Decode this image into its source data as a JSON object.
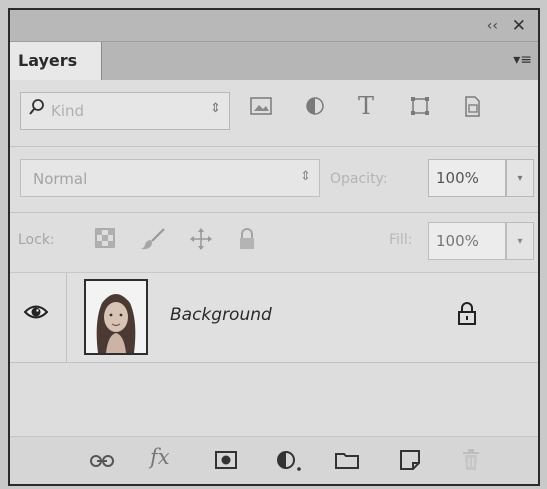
{
  "window": {
    "collapse_glyph": "‹‹",
    "close_glyph": "✕",
    "menu_glyph": "▾≡"
  },
  "tab": {
    "label": "Layers"
  },
  "filter": {
    "kind_label": "Kind",
    "kind_arrows": "⇕",
    "icons": [
      "image-filter-icon",
      "adjustment-filter-icon",
      "type-filter-icon",
      "shape-filter-icon",
      "smart-object-filter-icon"
    ],
    "type_glyph": "T"
  },
  "blend": {
    "mode": "Normal",
    "arrows": "⇕",
    "opacity_label": "Opacity:",
    "opacity_value": "100%",
    "dropdown_glyph": "▾"
  },
  "lock": {
    "label": "Lock:",
    "icons": [
      "lock-transparent-pixels-icon",
      "lock-image-pixels-icon",
      "lock-position-icon",
      "lock-all-icon"
    ],
    "fill_label": "Fill:",
    "fill_value": "100%",
    "dropdown_glyph": "▾"
  },
  "layers": [
    {
      "name": "Background",
      "visible": true,
      "locked": true
    }
  ],
  "bottom_toolbar": {
    "icons": [
      "link-layers-icon",
      "layer-style-fx-icon",
      "add-mask-icon",
      "new-adjustment-layer-icon",
      "new-group-folder-icon",
      "new-layer-icon",
      "delete-layer-trash-icon"
    ],
    "fx_glyph": "fx"
  },
  "colors": {
    "panel_bg": "#dedede",
    "tab_bg": "#e8e8e8",
    "frame_border": "#2b2b2b"
  }
}
